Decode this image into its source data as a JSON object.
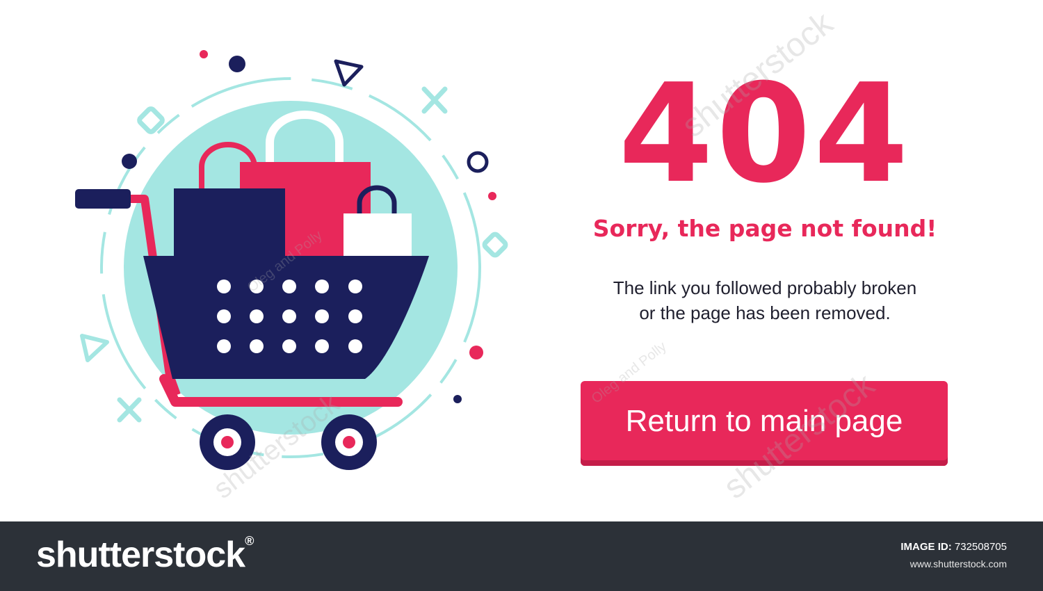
{
  "error": {
    "code": "404",
    "headline": "Sorry, the page not found!",
    "message_line1": "The link you followed probably broken",
    "message_line2": "or the page has been removed."
  },
  "actions": {
    "return_label": "Return to main page"
  },
  "watermark": {
    "brand": "shutterstock",
    "brand_mark": "®",
    "image_id_label": "IMAGE ID:",
    "image_id": "732508705",
    "site": "www.shutterstock.com",
    "overlay_text": "shutterstock",
    "author": "Oleg and Polly"
  },
  "colors": {
    "accent": "#e8285a",
    "navy": "#1b1f5c",
    "teal": "#a4e6e2",
    "bar": "#2c3138"
  },
  "icons": [
    "shopping-cart-icon",
    "shopping-bag-icon",
    "diamond-icon",
    "triangle-icon",
    "cross-icon",
    "ring-icon",
    "dot-icon"
  ]
}
